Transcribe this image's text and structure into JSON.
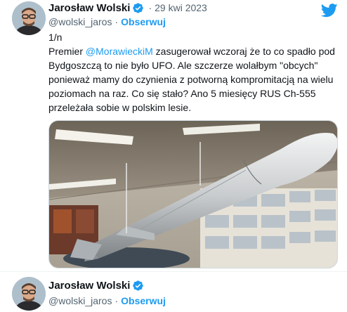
{
  "tweets": [
    {
      "author": "Jarosław Wolski",
      "handle": "@wolski_jaros",
      "date": "29 kwi 2023",
      "follow_label": "Obserwuj",
      "text_before": "1/n\nPremier ",
      "mention": "@MorawieckiM",
      "text_after": " zasugerował wczoraj że to co spadło pod Bydgoszczą to  nie było UFO.  Ale szczerze wolałbym \"obcych\" ponieważ mamy do czynienia z potworną kompromitacją na wielu poziomach na raz.  Co się stało? Ano 5 miesięcy RUS Ch-555 przeleżała sobie w polskim lesie."
    },
    {
      "author": "Jarosław Wolski",
      "handle": "@wolski_jaros",
      "follow_label": "Obserwuj"
    }
  ],
  "icons": {
    "brand": "twitter-bird-icon",
    "verified": "verified-badge-icon"
  },
  "colors": {
    "accent": "#1d9bf0",
    "text": "#0f1419",
    "secondary": "#536471"
  }
}
